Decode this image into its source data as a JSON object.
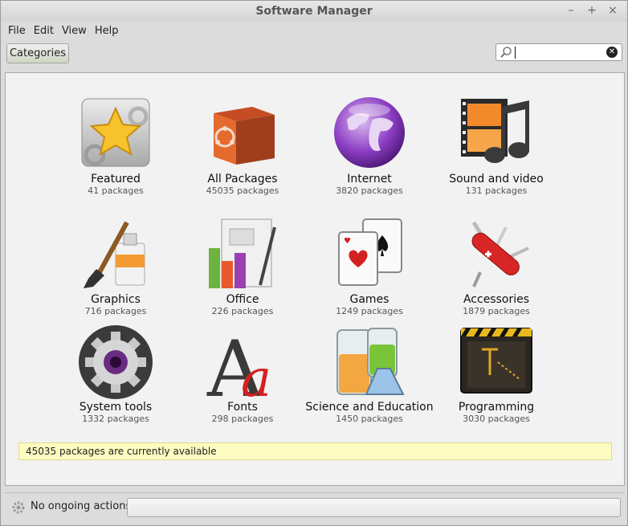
{
  "window": {
    "title": "Software Manager",
    "controls": [
      "–",
      "+",
      "×"
    ]
  },
  "menu": [
    "File",
    "Edit",
    "View",
    "Help"
  ],
  "toolbar": {
    "categories_label": "Categories",
    "search_value": ""
  },
  "categories": [
    {
      "name": "Featured",
      "count": "41 packages",
      "icon": "star-icon"
    },
    {
      "name": "All Packages",
      "count": "45035 packages",
      "icon": "box-icon"
    },
    {
      "name": "Internet",
      "count": "3820 packages",
      "icon": "globe-icon"
    },
    {
      "name": "Sound and video",
      "count": "131 packages",
      "icon": "media-icon"
    },
    {
      "name": "Graphics",
      "count": "716 packages",
      "icon": "paint-icon"
    },
    {
      "name": "Office",
      "count": "226 packages",
      "icon": "office-icon"
    },
    {
      "name": "Games",
      "count": "1249 packages",
      "icon": "cards-icon"
    },
    {
      "name": "Accessories",
      "count": "1879 packages",
      "icon": "multitool-icon"
    },
    {
      "name": "System tools",
      "count": "1332 packages",
      "icon": "gear-icon"
    },
    {
      "name": "Fonts",
      "count": "298 packages",
      "icon": "font-icon"
    },
    {
      "name": "Science and Education",
      "count": "1450 packages",
      "icon": "flask-icon"
    },
    {
      "name": "Programming",
      "count": "3030 packages",
      "icon": "terminal-icon"
    }
  ],
  "notice": "45035 packages are currently available",
  "status": {
    "text": "No ongoing actions"
  },
  "colors": {
    "notice_bg": "#fdfdc1",
    "accent_orange": "#e9692c"
  }
}
